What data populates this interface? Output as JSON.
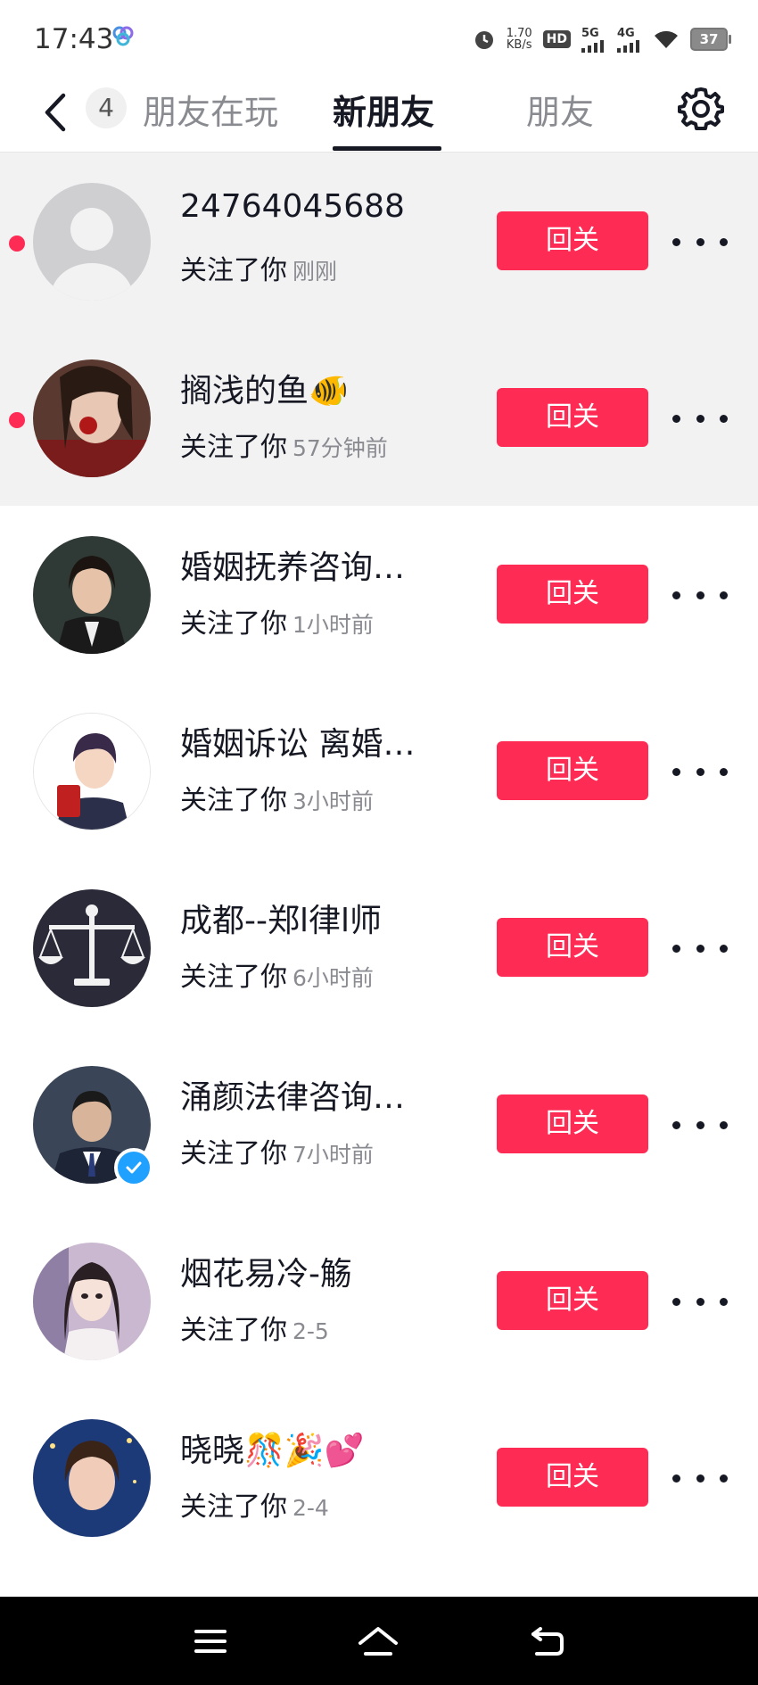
{
  "status_bar": {
    "time": "17:43",
    "speed_value": "1.70",
    "speed_unit": "KB/s",
    "hd_label": "HD",
    "net_5g": "5G",
    "net_4g": "4G",
    "battery": "37"
  },
  "nav": {
    "count": "4",
    "tabs": [
      "朋友在玩",
      "新朋友",
      "朋友"
    ],
    "active_tab": "新朋友"
  },
  "followers": [
    {
      "name": "24764045688",
      "action": "关注了你",
      "time": "刚刚",
      "button": "回关",
      "unread": true
    },
    {
      "name": "搁浅的鱼🐠",
      "action": "关注了你",
      "time": "57分钟前",
      "button": "回关",
      "unread": true
    },
    {
      "name": "婚姻抚养咨询…",
      "action": "关注了你",
      "time": "1小时前",
      "button": "回关",
      "unread": false
    },
    {
      "name": "婚姻诉讼  离婚…",
      "action": "关注了你",
      "time": "3小时前",
      "button": "回关",
      "unread": false
    },
    {
      "name": "成都--郑l律l师",
      "action": "关注了你",
      "time": "6小时前",
      "button": "回关",
      "unread": false
    },
    {
      "name": "涌颜法律咨询…",
      "action": "关注了你",
      "time": "7小时前",
      "button": "回关",
      "unread": false,
      "verified": true
    },
    {
      "name": "烟花易冷-觞",
      "action": "关注了你",
      "time": "2-5",
      "button": "回关",
      "unread": false
    },
    {
      "name": "晓晓🎊🎉💕",
      "action": "关注了你",
      "time": "2-4",
      "button": "回关",
      "unread": false
    }
  ],
  "colors": {
    "accent": "#fe2c55",
    "unread_bg": "#f2f2f3",
    "text_primary": "#161823",
    "text_secondary": "#8a8b91",
    "verified": "#20a0ff"
  },
  "icons": {
    "back": "chevron-left-icon",
    "settings": "gear-icon",
    "more": "more-dots-icon",
    "menu": "menu-icon",
    "home": "home-icon",
    "return": "return-icon"
  }
}
